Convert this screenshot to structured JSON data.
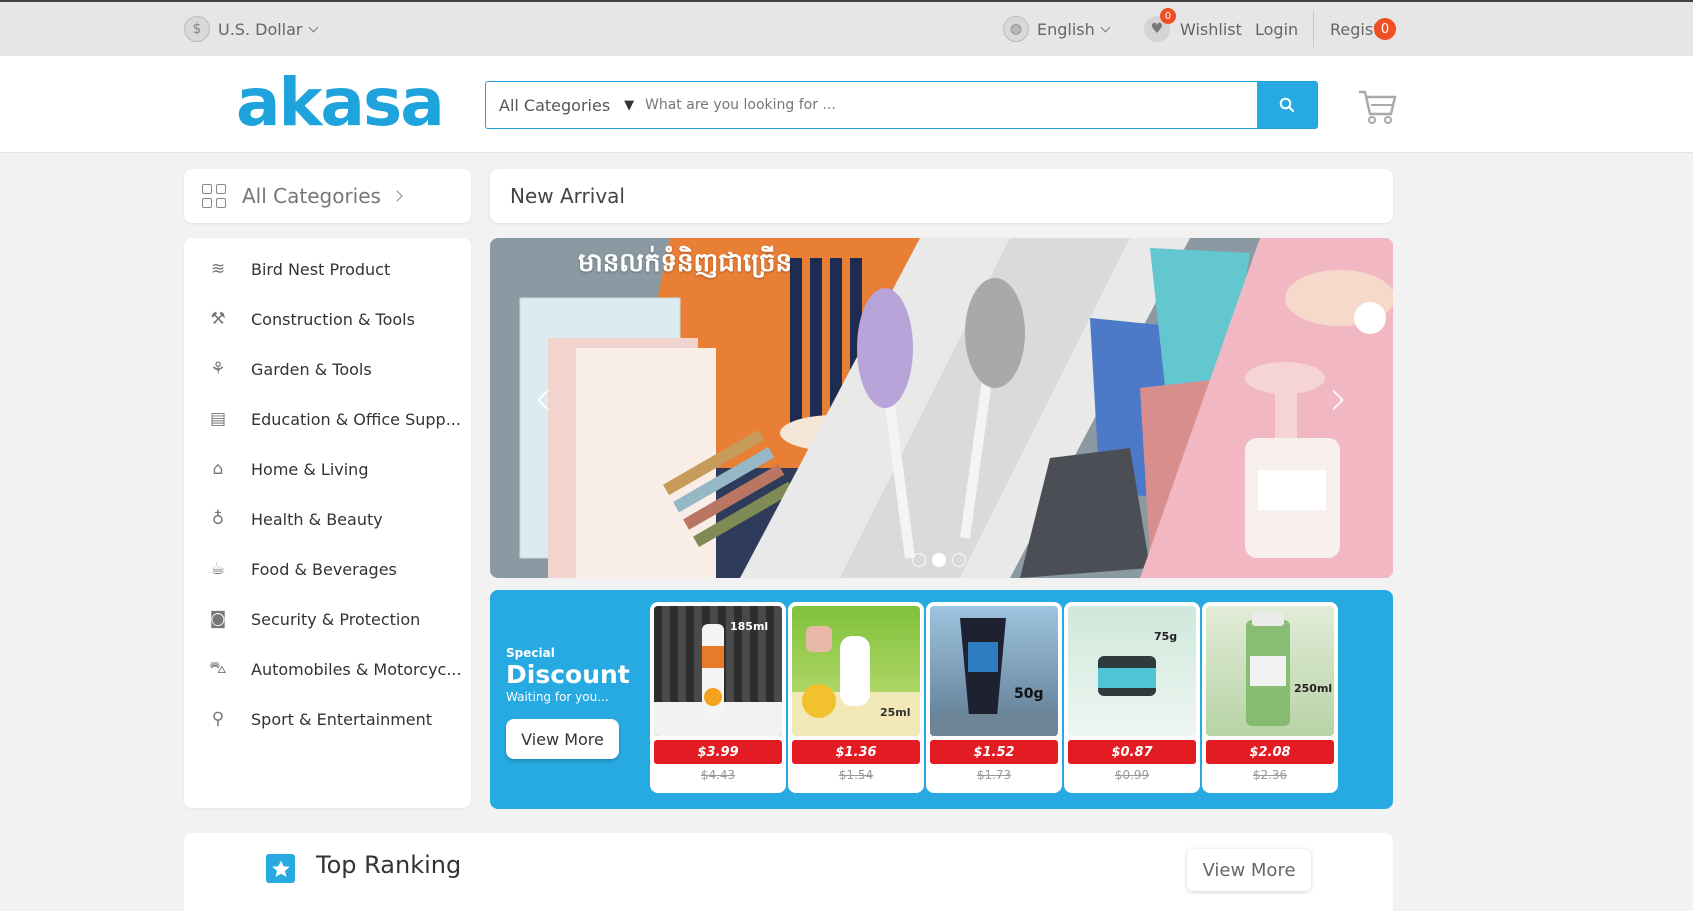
{
  "topbar": {
    "currency": "U.S. Dollar",
    "language": "English",
    "wishlist_count": "0",
    "wishlist_label": "Wishlist",
    "login_label": "Login",
    "register_label": "Register"
  },
  "header": {
    "logo_text": "akasa",
    "search": {
      "category_label": "All Categories",
      "placeholder": "What are you looking for ..."
    },
    "cart_count": "0"
  },
  "sidebar": {
    "all_categories_label": "All Categories",
    "items": [
      {
        "label": "Bird Nest Product",
        "icon": "bird-icon"
      },
      {
        "label": "Construction & Tools",
        "icon": "construction-icon"
      },
      {
        "label": "Garden & Tools",
        "icon": "garden-icon"
      },
      {
        "label": "Education & Office Supp...",
        "icon": "book-icon"
      },
      {
        "label": "Home & Living",
        "icon": "home-appliance-icon"
      },
      {
        "label": "Health & Beauty",
        "icon": "bottle-icon"
      },
      {
        "label": "Food & Beverages",
        "icon": "food-icon"
      },
      {
        "label": "Security & Protection",
        "icon": "camera-icon"
      },
      {
        "label": "Automobiles & Motorcyc...",
        "icon": "car-icon"
      },
      {
        "label": "Sport & Entertainment",
        "icon": "racket-icon"
      }
    ]
  },
  "main": {
    "new_arrival_label": "New Arrival",
    "banner": {
      "title_khmer": "មានលក់ទំនិញជាច្រើន",
      "slide_count": 3,
      "active_slide": 2
    },
    "discount": {
      "special_label": "Special",
      "title": "Discount",
      "subtitle": "Waiting for you...",
      "button_label": "View More",
      "products": [
        {
          "price": "$3.99",
          "old_price": "$4.43",
          "image_label": "185ml"
        },
        {
          "price": "$1.36",
          "old_price": "$1.54",
          "image_label": "25ml"
        },
        {
          "price": "$1.52",
          "old_price": "$1.73",
          "image_label": "50g"
        },
        {
          "price": "$0.87",
          "old_price": "$0.99",
          "image_label": "75g"
        },
        {
          "price": "$2.08",
          "old_price": "$2.36",
          "image_label": "250ml"
        }
      ]
    }
  },
  "ranking": {
    "title": "Top Ranking",
    "button_label": "View More"
  },
  "colors": {
    "brand_blue": "#27a9e1",
    "badge_orange": "#f04e23",
    "price_red": "#e31b23"
  }
}
